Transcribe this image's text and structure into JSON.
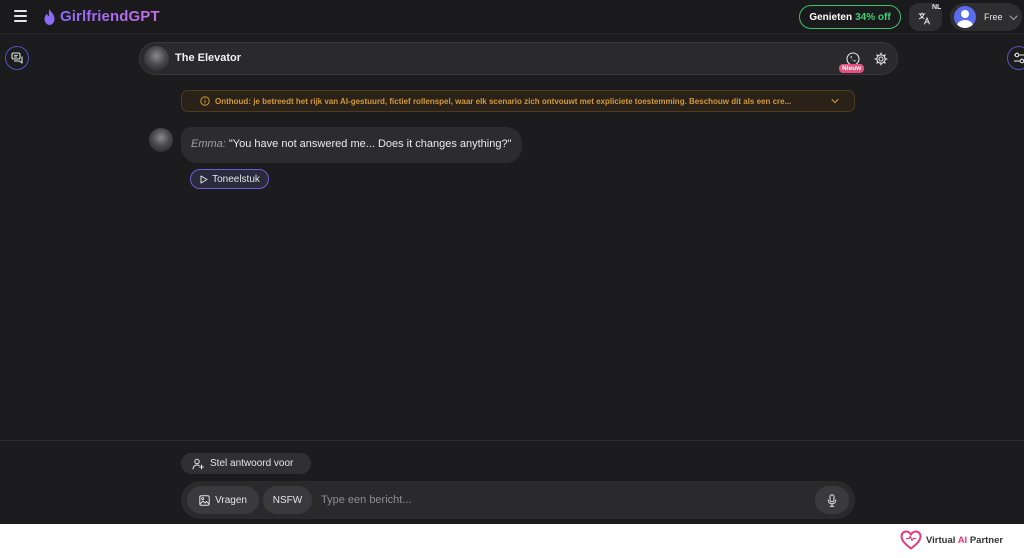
{
  "header": {
    "logo_text": "GirlfriendGPT",
    "promo": {
      "prefix": "Genieten",
      "percent": "34% off"
    },
    "language_code": "NL",
    "plan_label": "Free"
  },
  "chat_header": {
    "character_name": "The Elevator",
    "new_badge": "Nieuw"
  },
  "disclaimer": {
    "text": "Onthoud: je betreedt het rijk van AI-gestuurd, fictief rollenspel, waar elk scenario zich ontvouwt met expliciete toestemming. Beschouw dit als een cre..."
  },
  "messages": [
    {
      "speaker": "Emma:",
      "text": "\"You have not answered me... Does it changes anything?\""
    }
  ],
  "play_button_label": "Toneelstuk",
  "composer": {
    "suggest_label": "Stel antwoord voor",
    "image_label": "Vragen",
    "nsfw_label": "NSFW",
    "placeholder": "Type een bericht..."
  },
  "watermark": {
    "prefix": "Virtual ",
    "ai": "AI",
    "suffix": " Partner"
  },
  "colors": {
    "background": "#1c1c1e",
    "accent_purple": "#8b6bf5",
    "promo_green": "#41d072",
    "warning_text": "#d29a3a",
    "badge_pink": "#e2527e"
  },
  "icons": [
    "menu-icon",
    "flame-icon",
    "translate-icon",
    "chevron-down-icon",
    "chats-icon",
    "sliders-icon",
    "phone-call-icon",
    "gear-icon",
    "info-icon",
    "play-icon",
    "user-sparkle-icon",
    "image-icon",
    "mic-icon",
    "heart-logo-icon"
  ]
}
